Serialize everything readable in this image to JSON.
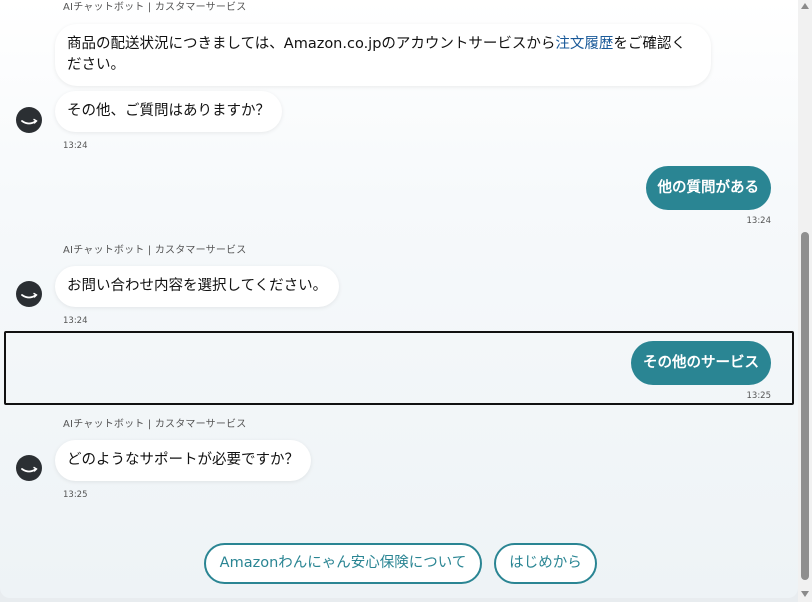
{
  "messages": {
    "m1": {
      "sender": "AIチャットボット | カスタマーサービス",
      "text_before": "商品の配送状況につきましては、Amazon.co.jpのアカウントサービスから",
      "link": "注文履歴",
      "text_after": "をご確認ください。"
    },
    "m2": {
      "text": "その他、ご質問はありますか？",
      "time": "13:24"
    },
    "u1": {
      "text": "他の質問がある",
      "time": "13:24"
    },
    "m3": {
      "sender": "AIチャットボット | カスタマーサービス",
      "text": "お問い合わせ内容を選択してください。",
      "time": "13:24"
    },
    "u2": {
      "text": "その他のサービス",
      "time": "13:25"
    },
    "m4": {
      "sender": "AIチャットボット | カスタマーサービス",
      "text": "どのようなサポートが必要ですか？",
      "time": "13:25"
    }
  },
  "quick_replies": {
    "insurance": "Amazonわんにゃん安心保険について",
    "restart": "はじめから"
  },
  "icons": {
    "avatar": "amazon-smile-icon"
  },
  "colors": {
    "accent": "#2a8593",
    "link": "#1a5a99",
    "avatar_bg": "#2b2f33"
  }
}
